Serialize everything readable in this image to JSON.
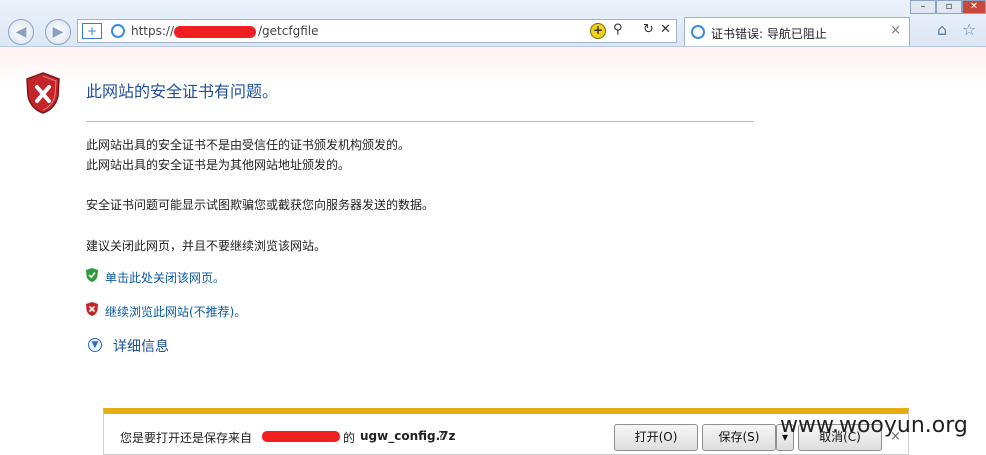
{
  "browser": {
    "url_prefix": "https://",
    "url_suffix": "/getcfgfile",
    "tab_title": "证书错误: 导航已阻止",
    "tab_close": "×",
    "icons": {
      "back": "back-arrow-icon",
      "forward": "forward-arrow-icon",
      "favorites": "plus-icon",
      "cert": "certificate-error-icon",
      "search": "search-icon",
      "refresh": "refresh-icon",
      "stop": "stop-icon",
      "home": "home-icon",
      "star": "favorites-star-icon"
    }
  },
  "error_page": {
    "title": "此网站的安全证书有问题。",
    "line1": "此网站出具的安全证书不是由受信任的证书颁发机构颁发的。",
    "line2": "此网站出具的安全证书是为其他网站地址颁发的。",
    "line3": "安全证书问题可能显示试图欺骗您或截获您向服务器发送的数据。",
    "line4": "建议关闭此网页，并且不要继续浏览该网站。",
    "link_close": "单击此处关闭该网页。",
    "link_continue": "继续浏览此网站(不推荐)。",
    "details": "详细信息"
  },
  "download_bar": {
    "prompt_start": "您是要打开还是保存来自",
    "prompt_of": "的",
    "filename": "ugw_config.7z",
    "prompt_end": "?",
    "open_label": "打开(O)",
    "save_label": "保存(S)",
    "cancel_label": "取消(C)",
    "close": "×"
  },
  "watermark": "www.wooyun.org",
  "colors": {
    "accent_blue": "#1f4e9b",
    "link_blue": "#0b5aa3",
    "download_bar_border": "#e6ad13",
    "redaction": "#f02020"
  }
}
